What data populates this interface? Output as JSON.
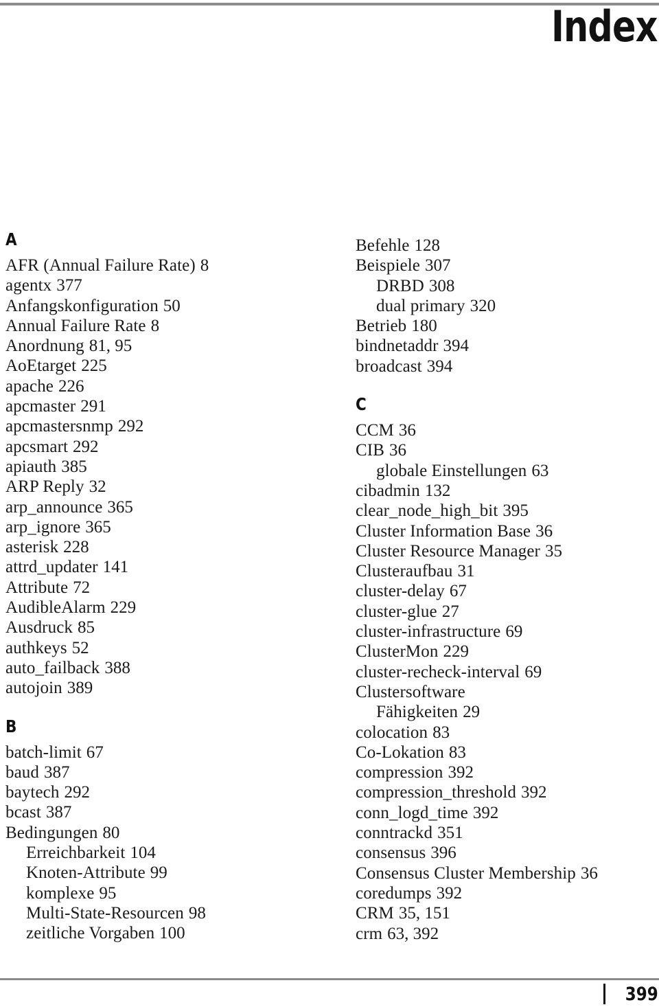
{
  "page": {
    "title": "Index",
    "page_number": "399"
  },
  "columns": [
    {
      "id": "left",
      "sections": [
        {
          "letter": "A",
          "entries": [
            {
              "term": "AFR (Annual Failure Rate)",
              "pages": "8",
              "level": 0
            },
            {
              "term": "agentx",
              "pages": "377",
              "level": 0
            },
            {
              "term": "Anfangskonfiguration",
              "pages": "50",
              "level": 0
            },
            {
              "term": "Annual Failure Rate",
              "pages": "8",
              "level": 0
            },
            {
              "term": "Anordnung",
              "pages": "81, 95",
              "level": 0
            },
            {
              "term": "AoEtarget",
              "pages": "225",
              "level": 0
            },
            {
              "term": "apache",
              "pages": "226",
              "level": 0
            },
            {
              "term": "apcmaster",
              "pages": "291",
              "level": 0
            },
            {
              "term": "apcmastersnmp",
              "pages": "292",
              "level": 0
            },
            {
              "term": "apcsmart",
              "pages": "292",
              "level": 0
            },
            {
              "term": "apiauth",
              "pages": "385",
              "level": 0
            },
            {
              "term": "ARP Reply",
              "pages": "32",
              "level": 0
            },
            {
              "term": "arp_announce",
              "pages": "365",
              "level": 0
            },
            {
              "term": "arp_ignore",
              "pages": "365",
              "level": 0
            },
            {
              "term": "asterisk",
              "pages": "228",
              "level": 0
            },
            {
              "term": "attrd_updater",
              "pages": "141",
              "level": 0
            },
            {
              "term": "Attribute",
              "pages": "72",
              "level": 0
            },
            {
              "term": "AudibleAlarm",
              "pages": "229",
              "level": 0
            },
            {
              "term": "Ausdruck",
              "pages": "85",
              "level": 0
            },
            {
              "term": "authkeys",
              "pages": "52",
              "level": 0
            },
            {
              "term": "auto_failback",
              "pages": "388",
              "level": 0
            },
            {
              "term": "autojoin",
              "pages": "389",
              "level": 0
            }
          ]
        },
        {
          "letter": "B",
          "entries": [
            {
              "term": "batch-limit",
              "pages": "67",
              "level": 0
            },
            {
              "term": "baud",
              "pages": "387",
              "level": 0
            },
            {
              "term": "baytech",
              "pages": "292",
              "level": 0
            },
            {
              "term": "bcast",
              "pages": "387",
              "level": 0
            },
            {
              "term": "Bedingungen",
              "pages": "80",
              "level": 0
            },
            {
              "term": "Erreichbarkeit",
              "pages": "104",
              "level": 1
            },
            {
              "term": "Knoten-Attribute",
              "pages": "99",
              "level": 1
            },
            {
              "term": "komplexe",
              "pages": "95",
              "level": 1
            },
            {
              "term": "Multi-State-Resourcen",
              "pages": "98",
              "level": 1
            },
            {
              "term": "zeitliche Vorgaben",
              "pages": "100",
              "level": 1
            }
          ]
        }
      ]
    },
    {
      "id": "right",
      "sections": [
        {
          "letter": "",
          "entries": [
            {
              "term": "Befehle",
              "pages": "128",
              "level": 0
            },
            {
              "term": "Beispiele",
              "pages": "307",
              "level": 0
            },
            {
              "term": "DRBD",
              "pages": "308",
              "level": 1
            },
            {
              "term": "dual primary",
              "pages": "320",
              "level": 1
            },
            {
              "term": "Betrieb",
              "pages": "180",
              "level": 0
            },
            {
              "term": "bindnetaddr",
              "pages": "394",
              "level": 0
            },
            {
              "term": "broadcast",
              "pages": "394",
              "level": 0
            }
          ]
        },
        {
          "letter": "C",
          "entries": [
            {
              "term": "CCM",
              "pages": "36",
              "level": 0
            },
            {
              "term": "CIB",
              "pages": "36",
              "level": 0
            },
            {
              "term": "globale Einstellungen",
              "pages": "63",
              "level": 1
            },
            {
              "term": "cibadmin",
              "pages": "132",
              "level": 0
            },
            {
              "term": "clear_node_high_bit",
              "pages": "395",
              "level": 0
            },
            {
              "term": "Cluster Information Base",
              "pages": "36",
              "level": 0
            },
            {
              "term": "Cluster Resource Manager",
              "pages": "35",
              "level": 0
            },
            {
              "term": "Clusteraufbau",
              "pages": "31",
              "level": 0
            },
            {
              "term": "cluster-delay",
              "pages": "67",
              "level": 0
            },
            {
              "term": "cluster-glue",
              "pages": "27",
              "level": 0
            },
            {
              "term": "cluster-infrastructure",
              "pages": "69",
              "level": 0
            },
            {
              "term": "ClusterMon",
              "pages": "229",
              "level": 0
            },
            {
              "term": "cluster-recheck-interval",
              "pages": "69",
              "level": 0
            },
            {
              "term": "Clustersoftware",
              "pages": "",
              "level": 0
            },
            {
              "term": "Fähigkeiten",
              "pages": "29",
              "level": 1
            },
            {
              "term": "colocation",
              "pages": "83",
              "level": 0
            },
            {
              "term": "Co-Lokation",
              "pages": "83",
              "level": 0
            },
            {
              "term": "compression",
              "pages": "392",
              "level": 0
            },
            {
              "term": "compression_threshold",
              "pages": "392",
              "level": 0
            },
            {
              "term": "conn_logd_time",
              "pages": "392",
              "level": 0
            },
            {
              "term": "conntrackd",
              "pages": "351",
              "level": 0
            },
            {
              "term": "consensus",
              "pages": "396",
              "level": 0
            },
            {
              "term": "Consensus Cluster Membership",
              "pages": "36",
              "level": 0
            },
            {
              "term": "coredumps",
              "pages": "392",
              "level": 0
            },
            {
              "term": "CRM",
              "pages": "35, 151",
              "level": 0
            },
            {
              "term": "crm",
              "pages": "63, 392",
              "level": 0
            }
          ]
        }
      ]
    }
  ]
}
